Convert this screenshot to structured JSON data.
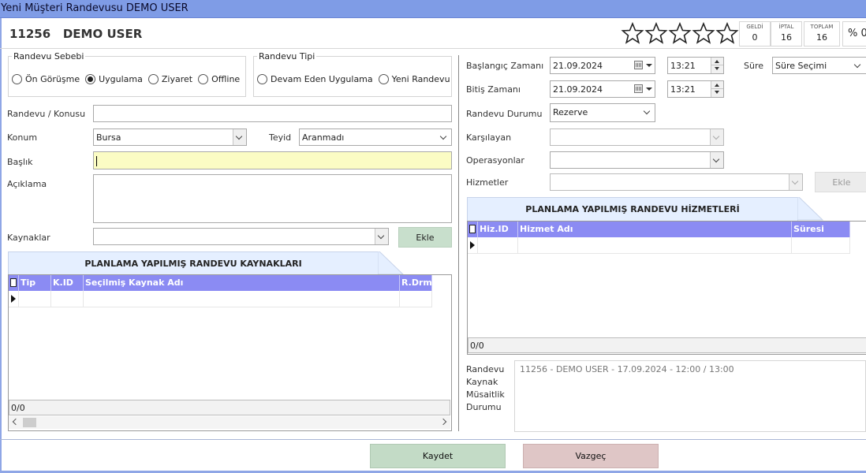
{
  "window": {
    "title": "Yeni Müşteri Randevusu DEMO USER"
  },
  "header": {
    "customer_id": "11256",
    "customer_name": "DEMO USER",
    "rating": {
      "stars_filled": 0,
      "stars_total": 5
    },
    "stats": [
      {
        "label": "GELDİ",
        "value": "0"
      },
      {
        "label": "İPTAL",
        "value": "16"
      },
      {
        "label": "TOPLAM",
        "value": "16"
      }
    ],
    "percent": "% 0"
  },
  "reason_group": {
    "legend": "Randevu Sebebi",
    "options": [
      {
        "label": "Ön Görüşme",
        "selected": false
      },
      {
        "label": "Uygulama",
        "selected": true
      },
      {
        "label": "Ziyaret",
        "selected": false
      },
      {
        "label": "Offline",
        "selected": false
      }
    ]
  },
  "type_group": {
    "legend": "Randevu Tipi",
    "options": [
      {
        "label": "Devam Eden Uygulama",
        "selected": false
      },
      {
        "label": "Yeni Randevu",
        "selected": false
      }
    ]
  },
  "form": {
    "subject_label": "Randevu / Konusu",
    "subject_value": "",
    "location_label": "Konum",
    "location_value": "Bursa",
    "confirm_label": "Teyid",
    "confirm_value": "Aranmadı",
    "heading_label": "Başlık",
    "heading_value": "",
    "description_label": "Açıklama",
    "description_value": "",
    "resources_label": "Kaynaklar",
    "resources_value": "",
    "add_label": "Ekle"
  },
  "resources_panel": {
    "tab_title": "PLANLAMA YAPILMIŞ RANDEVU KAYNAKLARI",
    "columns": [
      "Tip",
      "K.ID",
      "Seçilmiş Kaynak Adı",
      "R.Drm"
    ],
    "footer": "0/0"
  },
  "schedule": {
    "start_label": "Başlangıç Zamanı",
    "start_date": "21.09.2024",
    "start_time": "13:21",
    "end_label": "Bitiş Zamanı",
    "end_date": "21.09.2024",
    "end_time": "13:21",
    "duration_label": "Süre",
    "duration_value": "Süre Seçimi",
    "status_label": "Randevu Durumu",
    "status_value": "Rezerve",
    "greeter_label": "Karşılayan",
    "greeter_value": "",
    "operations_label": "Operasyonlar",
    "operations_value": "",
    "services_label": "Hizmetler",
    "services_value": "",
    "add_label": "Ekle"
  },
  "services_panel": {
    "tab_title": "PLANLAMA YAPILMIŞ RANDEVU HİZMETLERİ",
    "columns": [
      "Hiz.ID",
      "Hizmet Adı",
      "Süresi"
    ],
    "footer": "0/0"
  },
  "availability": {
    "label_lines": [
      "Randevu",
      "Kaynak",
      "Müsaitlik",
      "Durumu"
    ],
    "text": "11256 - DEMO USER - 17.09.2024 - 12:00 / 13:00"
  },
  "actions": {
    "save_label": "Kaydet",
    "cancel_label": "Vazgeç"
  },
  "colors": {
    "titlebar": "#7f9ce6",
    "grid_header": "#8b8bf3",
    "heading_field": "#fbfcc4",
    "save": "#c3dbc6",
    "cancel": "#dfc6c6"
  }
}
